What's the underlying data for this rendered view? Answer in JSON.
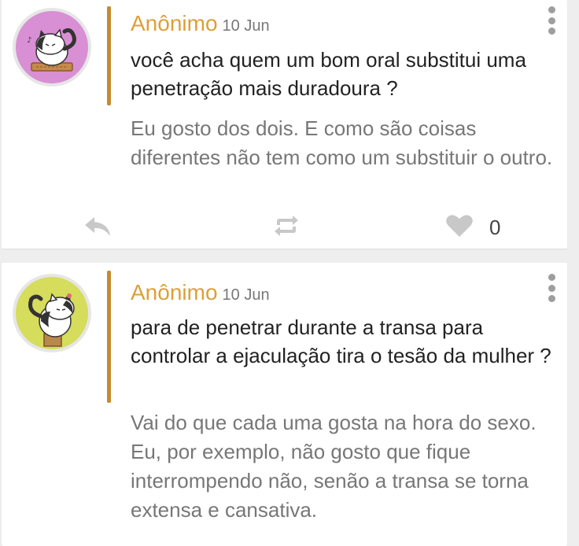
{
  "colors": {
    "accent": "#c58a2e",
    "author_name": "#dd9f38",
    "icon_gray": "#c8c8c8",
    "avatar1_bg": "#d98fd3",
    "avatar2_bg": "#d6dc5b"
  },
  "posts": [
    {
      "author": "Anônimo",
      "date": "10 Jun",
      "question": "você acha quem um bom oral substitui uma penetração mais duradoura ?",
      "answer": "Eu gosto dos dois. E como são coisas diferentes não tem como um substituir o outro.",
      "likes": "0",
      "avatar_icon": "cat-sitting-on-keyboard-icon"
    },
    {
      "author": "Anônimo",
      "date": "10 Jun",
      "question": "para de penetrar durante a transa para controlar a ejaculação tira o tesão da mulher ?",
      "answer": "Vai do que cada uma gosta na hora do sexo. Eu, por exemplo, não gosto que fique interrompendo não, senão a transa se torna extensa e cansativa.",
      "avatar_icon": "cat-in-box-icon"
    }
  ],
  "actions": {
    "reply_icon": "reply-arrow-icon",
    "repost_icon": "repost-icon",
    "like_icon": "heart-icon",
    "menu_icon": "more-vertical-icon"
  }
}
